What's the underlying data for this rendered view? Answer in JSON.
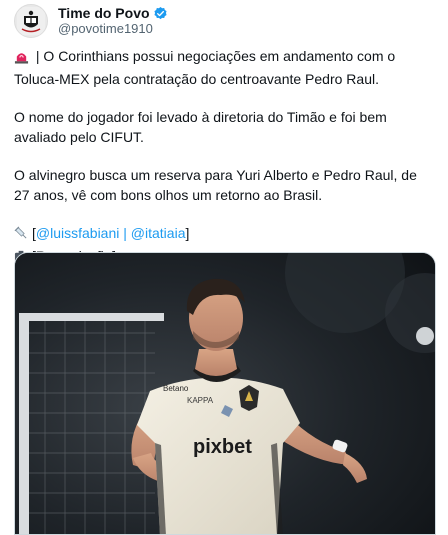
{
  "author": {
    "display_name": "Time do Povo",
    "handle": "@povotime1910",
    "avatar_icon": "club-crest-icon",
    "verified_color": "#1d9bf0"
  },
  "post": {
    "line1_text": " | O Corinthians possui negociações em andamento com o Toluca-MEX pela contratação do centroavante Pedro Raul.",
    "line2_text": "O nome do jogador foi levado à diretoria do Timão e foi bem avaliado pelo CIFUT.",
    "line3_text": "O alvinegro busca um reserva para Yuri Alberto e Pedro Raul, de 27 anos, vê com bons olhos um retorno ao Brasil.",
    "credit_open": "[",
    "mention1": "@luissfabiani",
    "separator": " | ",
    "mention2": "@itatiaia",
    "credit_close": "]",
    "photo_credit": "[Reprodução]"
  },
  "media": {
    "description": "photo",
    "jersey_sponsor": "pixbet",
    "jersey_sleeve": "Betano",
    "jersey_brand": "KAPPA"
  },
  "colors": {
    "link": "#1d9bf0",
    "secondary_text": "#536471"
  }
}
